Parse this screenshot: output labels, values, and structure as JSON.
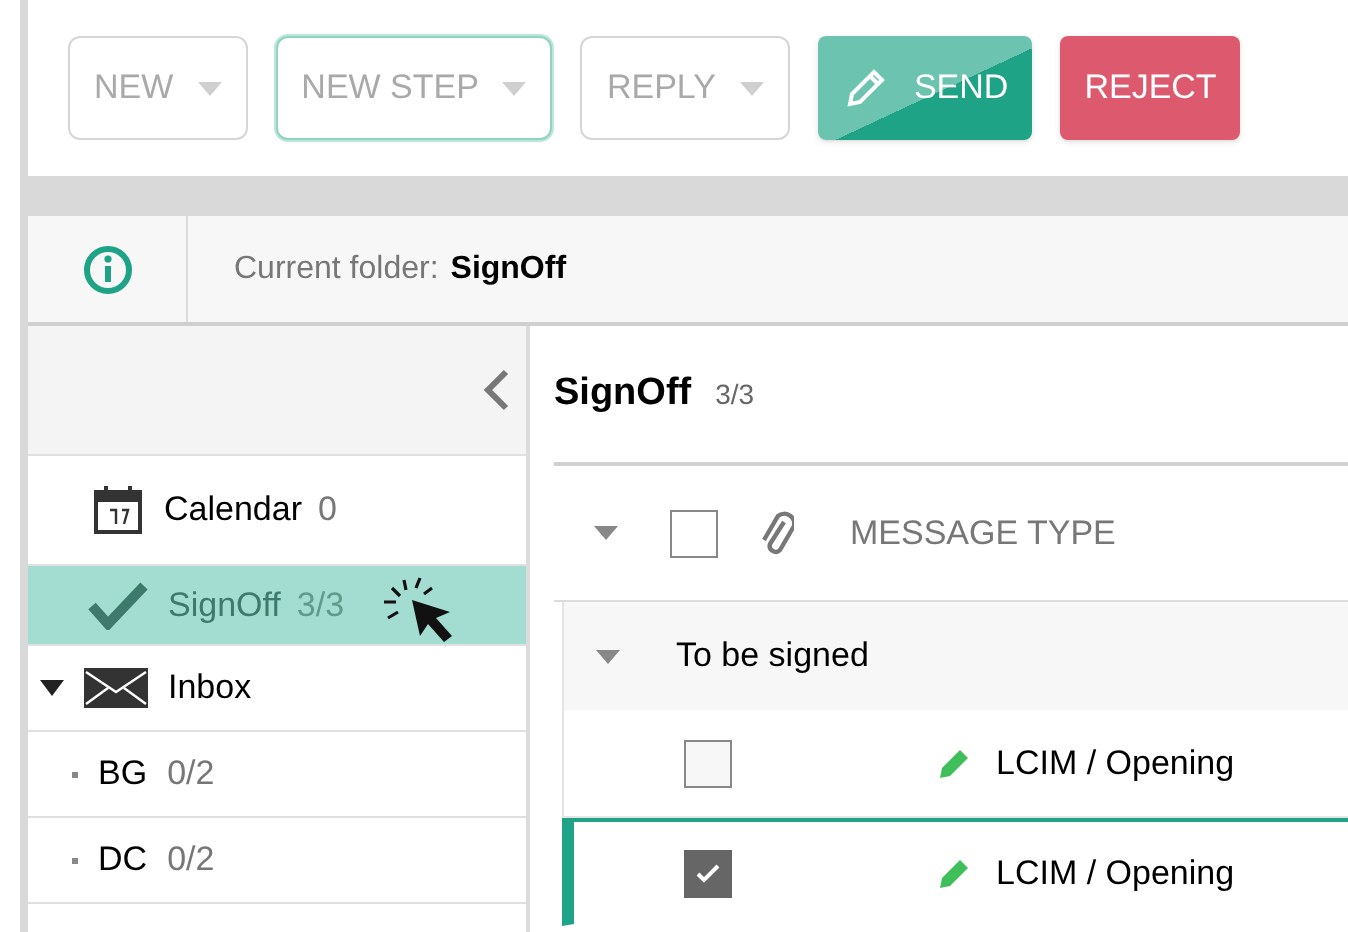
{
  "toolbar": {
    "buttons": [
      {
        "label": "NEW",
        "kind": "dropdown",
        "focused": false
      },
      {
        "label": "NEW STEP",
        "kind": "dropdown",
        "focused": true
      },
      {
        "label": "REPLY",
        "kind": "dropdown",
        "focused": false
      },
      {
        "label": "SEND",
        "kind": "send"
      },
      {
        "label": "REJECT",
        "kind": "reject"
      }
    ]
  },
  "info_bar": {
    "label": "Current folder:",
    "folder": "SignOff"
  },
  "sidebar": {
    "items": [
      {
        "kind": "calendar",
        "label": "Calendar",
        "count": "0",
        "selected": false
      },
      {
        "kind": "check",
        "label": "SignOff",
        "count": "3/3",
        "selected": true
      },
      {
        "kind": "mail",
        "label": "Inbox",
        "expanded": true,
        "selected": false,
        "children": [
          {
            "label": "BG",
            "count": "0/2",
            "selected": false
          },
          {
            "label": "DC",
            "count": "0/2",
            "selected": false
          }
        ]
      }
    ]
  },
  "folder": {
    "title": "SignOff",
    "count": "3/3"
  },
  "table": {
    "columns": [
      "MESSAGE TYPE"
    ],
    "header_checked": false,
    "groups": [
      {
        "label": "To be signed",
        "expanded": true,
        "rows": [
          {
            "type": "LCIM / Opening",
            "checked": false,
            "selected": false
          },
          {
            "type": "LCIM / Opening",
            "checked": true,
            "selected": true
          }
        ]
      }
    ]
  }
}
